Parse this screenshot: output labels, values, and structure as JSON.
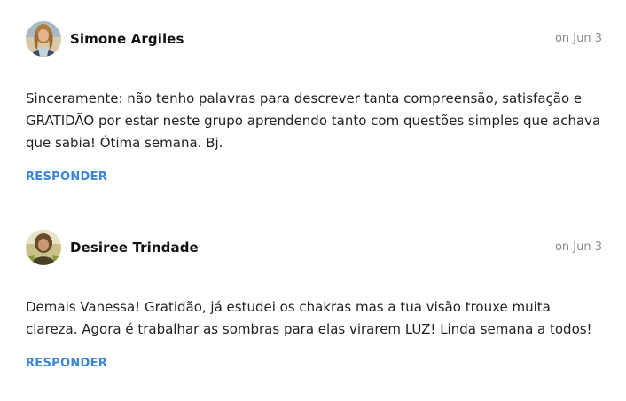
{
  "comments": [
    {
      "author": "Simone Argiles",
      "date": "on Jun 3",
      "text": "Sinceramente: não tenho palavras para descrever tanta compreensão, satisfação e GRATIDÃO por estar neste grupo aprendendo tanto com questões simples que achava que sabia! Ótima semana. Bj.",
      "reply_label": "RESPONDER",
      "avatar_icon": "user-avatar-photo"
    },
    {
      "author": "Desiree Trindade",
      "date": "on Jun 3",
      "text": "Demais Vanessa! Gratidão, já estudei os chakras mas a tua visão trouxe muita clareza. Agora é trabalhar as sombras para elas virarem LUZ! Linda semana a todos!",
      "reply_label": "RESPONDER",
      "avatar_icon": "user-avatar-photo"
    }
  ],
  "colors": {
    "reply_link": "#3b86d6",
    "date_text": "#8a8a8a",
    "body_text": "#222222"
  }
}
